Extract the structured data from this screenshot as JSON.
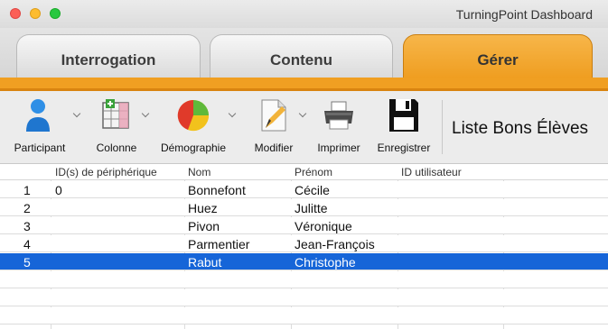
{
  "window": {
    "title": "TurningPoint Dashboard"
  },
  "tabs": [
    {
      "label": "Interrogation",
      "active": false
    },
    {
      "label": "Contenu",
      "active": false
    },
    {
      "label": "Gérer",
      "active": true
    }
  ],
  "toolbar": {
    "participant_label": "Participant",
    "colonne_label": "Colonne",
    "demographie_label": "Démographie",
    "modifier_label": "Modifier",
    "imprimer_label": "Imprimer",
    "enregistrer_label": "Enregistrer",
    "list_name": "Liste Bons Élèves"
  },
  "table": {
    "columns": [
      "ID(s) de périphérique",
      "Nom",
      "Prénom",
      "ID utilisateur"
    ],
    "rows": [
      {
        "num": "1",
        "device": "0",
        "nom": "Bonnefont",
        "prenom": "Cécile",
        "user_id": ""
      },
      {
        "num": "2",
        "device": "",
        "nom": "Huez",
        "prenom": "Julitte",
        "user_id": ""
      },
      {
        "num": "3",
        "device": "",
        "nom": "Pivon",
        "prenom": "Véronique",
        "user_id": ""
      },
      {
        "num": "4",
        "device": "",
        "nom": "Parmentier",
        "prenom": "Jean-François",
        "user_id": ""
      },
      {
        "num": "5",
        "device": "",
        "nom": "Rabut",
        "prenom": "Christophe",
        "user_id": "",
        "selected": true
      }
    ]
  },
  "colors": {
    "accent_orange": "#f09f22",
    "selection_blue": "#1665d8"
  }
}
